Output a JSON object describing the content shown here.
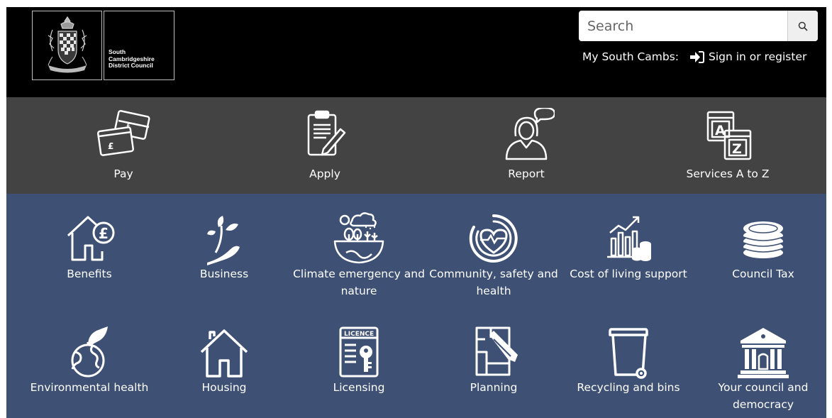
{
  "header": {
    "logo_lines": [
      "South",
      "Cambridgeshire",
      "District Council"
    ],
    "search_placeholder": "Search",
    "account_label": "My South Cambs:",
    "signin_label": "Sign in or register"
  },
  "topnav": [
    {
      "label": "Pay",
      "icon": "credit-cards-icon"
    },
    {
      "label": "Apply",
      "icon": "clipboard-pen-icon"
    },
    {
      "label": "Report",
      "icon": "person-speech-icon"
    },
    {
      "label": "Services A to Z",
      "icon": "a-to-z-icon"
    }
  ],
  "services": [
    {
      "label": "Benefits",
      "icon": "house-pound-icon"
    },
    {
      "label": "Business",
      "icon": "hand-plant-icon"
    },
    {
      "label": "Climate emergency and nature",
      "icon": "climate-icon"
    },
    {
      "label": "Community, safety and health",
      "icon": "heart-circle-icon"
    },
    {
      "label": "Cost of living support",
      "icon": "chart-coins-icon"
    },
    {
      "label": "Council Tax",
      "icon": "coin-stack-icon"
    },
    {
      "label": "Environmental health",
      "icon": "globe-leaf-icon"
    },
    {
      "label": "Housing",
      "icon": "house-icon"
    },
    {
      "label": "Licensing",
      "icon": "licence-icon"
    },
    {
      "label": "Planning",
      "icon": "plan-pencil-icon"
    },
    {
      "label": "Recycling and bins",
      "icon": "bin-icon"
    },
    {
      "label": "Your council and democracy",
      "icon": "council-building-icon"
    }
  ],
  "licence_icon_text": "LICENCE",
  "colors": {
    "header_bg": "#000000",
    "topnav_bg": "#434343",
    "services_bg": "#3e5073"
  }
}
